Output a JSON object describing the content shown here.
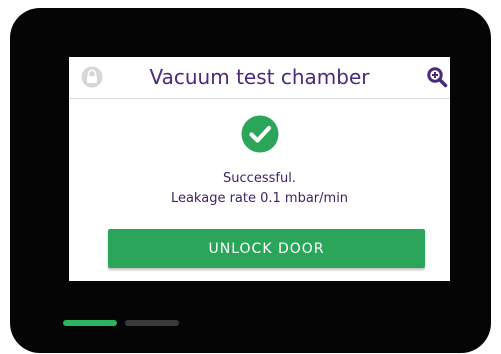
{
  "header": {
    "title": "Vacuum test chamber",
    "left_icon": "lock-icon",
    "right_icon": "zoom-icon"
  },
  "status": {
    "icon": "check-circle-icon",
    "line1": "Successful.",
    "line2": "Leakage rate 0.1 mbar/min"
  },
  "action": {
    "unlock_label": "UNLOCK DOOR"
  },
  "page_indicator": {
    "count": 2,
    "active_index": 0
  },
  "colors": {
    "accent_green": "#2aa55a",
    "title_purple": "#4a2a7a",
    "device_black": "#050505"
  }
}
